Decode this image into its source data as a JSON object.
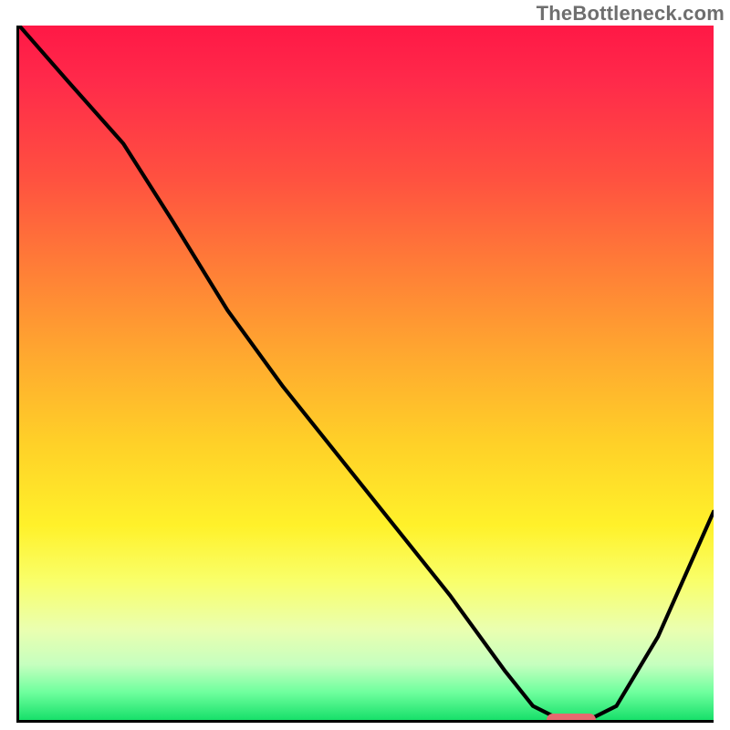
{
  "watermark": "TheBottleneck.com",
  "chart_data": {
    "type": "line",
    "title": "",
    "xlabel": "",
    "ylabel": "",
    "xlim": [
      0,
      100
    ],
    "ylim": [
      0,
      100
    ],
    "grid": false,
    "series": [
      {
        "name": "bottleneck-curve",
        "x": [
          0,
          7,
          15,
          22,
          30,
          38,
          46,
          54,
          62,
          70,
          74,
          78,
          82,
          86,
          92,
          100
        ],
        "y": [
          100,
          92,
          83,
          72,
          59,
          48,
          38,
          28,
          18,
          7,
          2,
          0,
          0,
          2,
          12,
          30
        ]
      }
    ],
    "marker": {
      "x_start": 76,
      "x_end": 83,
      "y": 0,
      "color": "#e56a6f"
    },
    "gradient_stops": [
      {
        "pos": 0,
        "color": "#ff1846"
      },
      {
        "pos": 8,
        "color": "#ff2a4a"
      },
      {
        "pos": 22,
        "color": "#ff5140"
      },
      {
        "pos": 35,
        "color": "#ff7e37"
      },
      {
        "pos": 48,
        "color": "#ffaa2f"
      },
      {
        "pos": 60,
        "color": "#ffd028"
      },
      {
        "pos": 72,
        "color": "#fff12a"
      },
      {
        "pos": 80,
        "color": "#f9ff6a"
      },
      {
        "pos": 87,
        "color": "#eaffb0"
      },
      {
        "pos": 92,
        "color": "#c6ffbf"
      },
      {
        "pos": 96,
        "color": "#6fff9e"
      },
      {
        "pos": 100,
        "color": "#17e06a"
      }
    ]
  }
}
